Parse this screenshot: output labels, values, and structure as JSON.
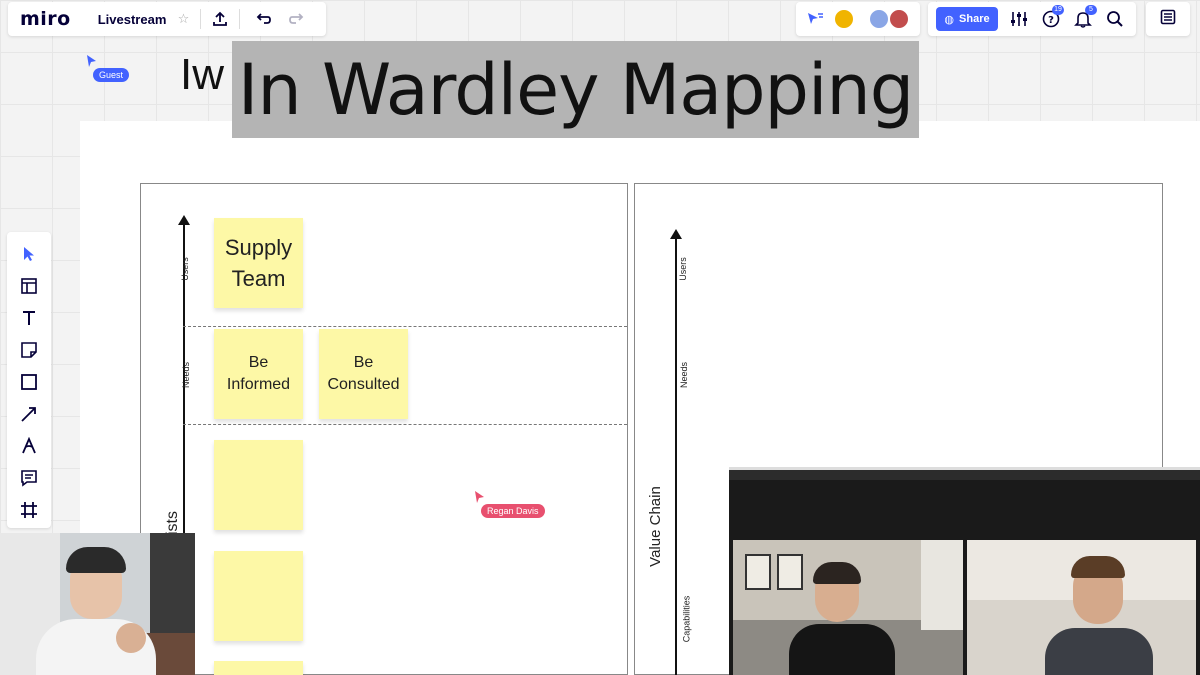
{
  "app": {
    "logo": "miro",
    "board_name": "Livestream"
  },
  "collaborators": {
    "help_badge": "19",
    "notifications_badge": "5"
  },
  "toolbar": {
    "share_label": "Share"
  },
  "canvas": {
    "partial_text": "Iw",
    "guest_cursor_label": "Guest",
    "remote_cursor_label": "Regan Davis"
  },
  "title_overlay": "In Wardley Mapping",
  "left_map": {
    "labels": {
      "users": "Users",
      "needs": "Needs",
      "partial_axis": "ists"
    },
    "stickies": {
      "supply_team": "Supply Team",
      "be_informed": "Be Informed",
      "be_consulted": "Be Consulted"
    }
  },
  "right_map": {
    "labels": {
      "users": "Users",
      "needs": "Needs",
      "value_chain": "Value Chain",
      "capabilities": "Capabilities"
    }
  },
  "colors": {
    "accent": "#4262ff",
    "sticky": "#fdf8a6",
    "cursor_tag": "#e8506f",
    "overlay": "#b4b4b4"
  }
}
